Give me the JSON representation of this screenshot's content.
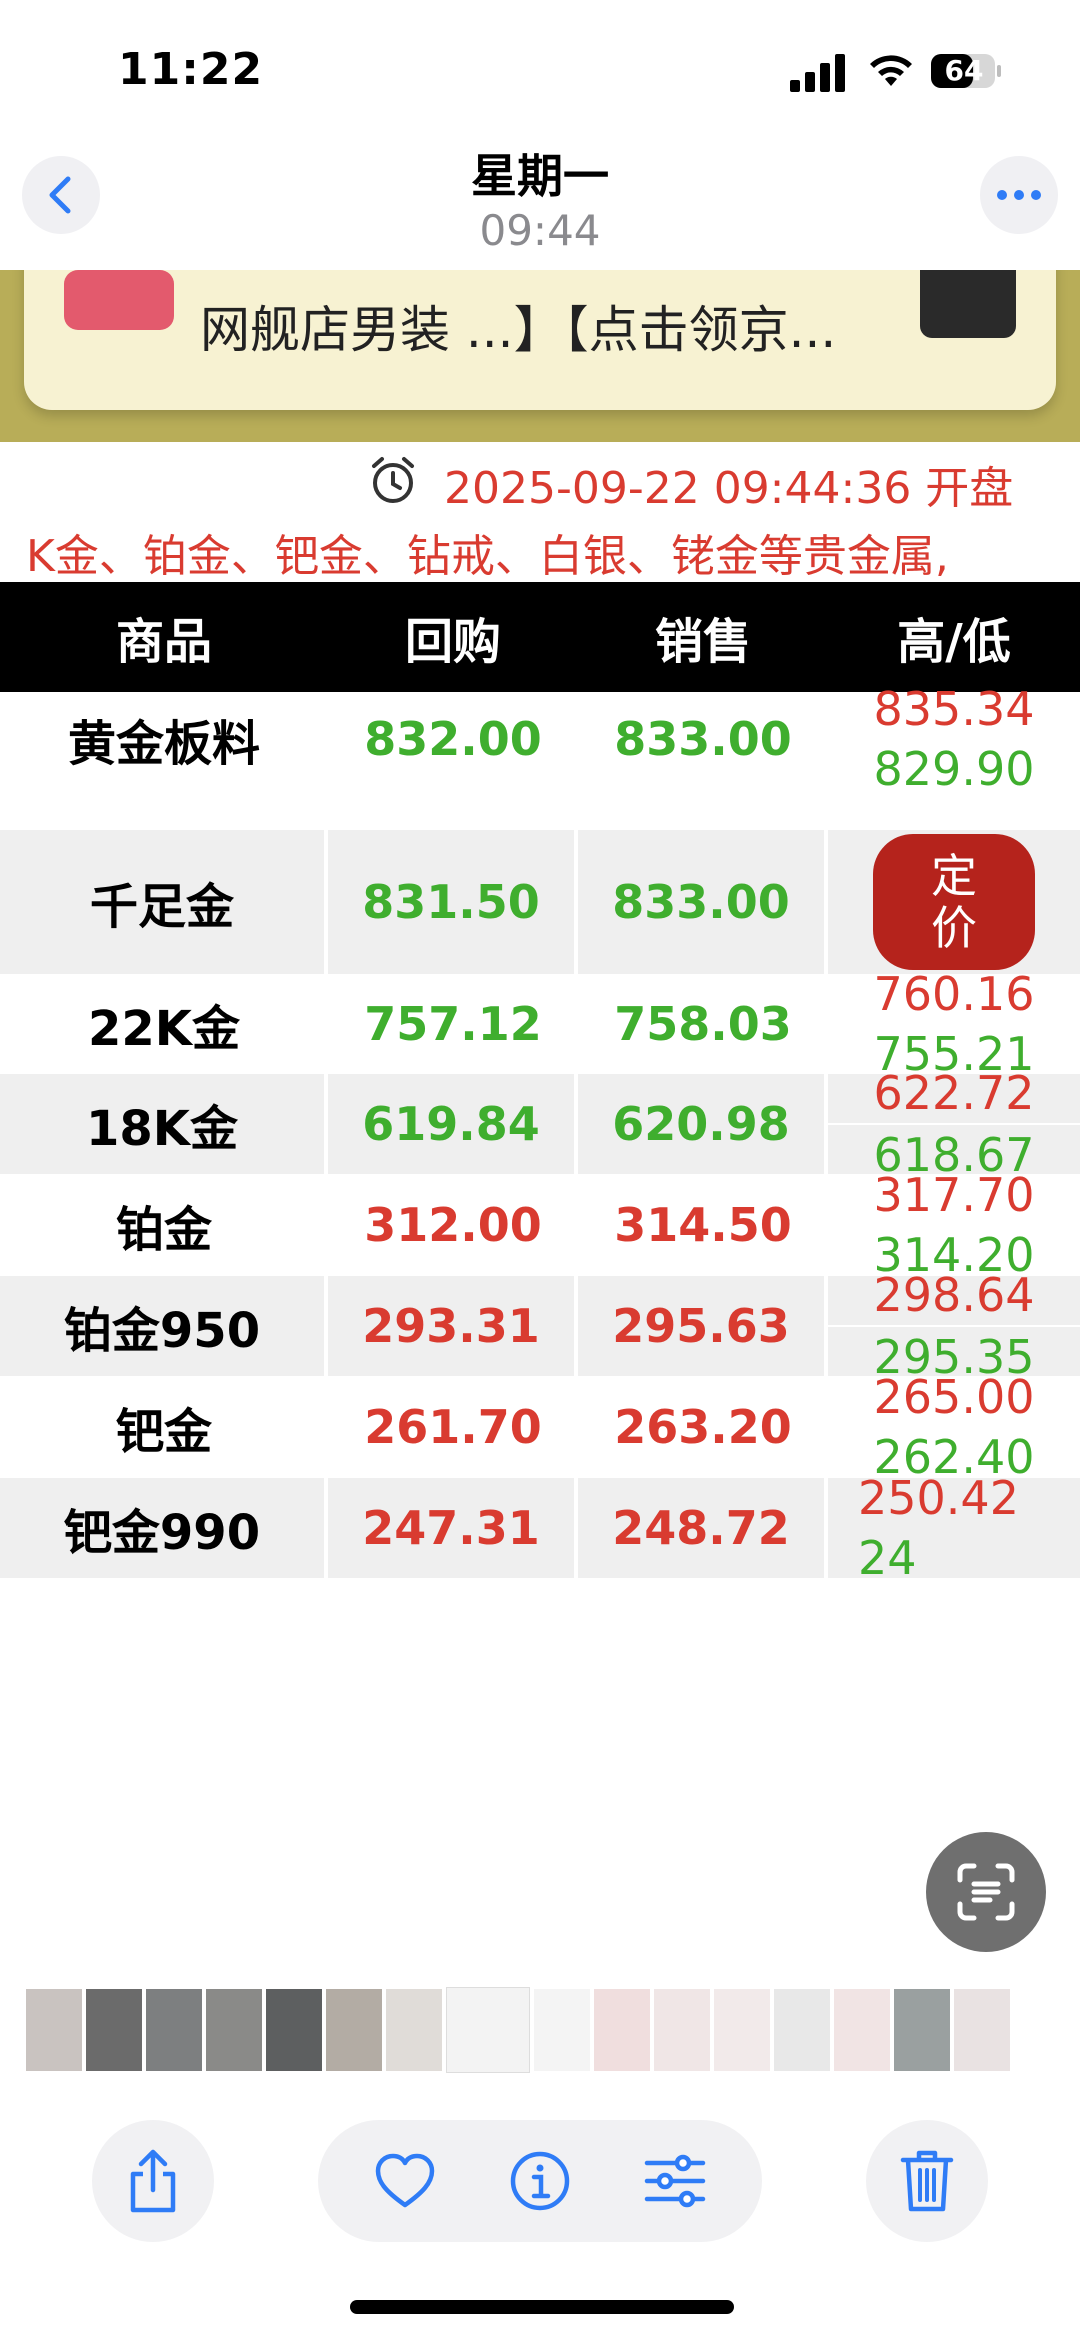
{
  "status_bar": {
    "time": "11:22",
    "battery": "64"
  },
  "nav": {
    "title": "星期一",
    "subtitle": "09:44"
  },
  "banner": {
    "text": "网舰店男装 ...】【点击领京..."
  },
  "info": {
    "datetime": "2025-09-22 09:44:36  开盘",
    "scroll_text": "K金、铂金、钯金、钻戒、白银、铑金等贵金属,"
  },
  "table": {
    "headers": [
      "商品",
      "回购",
      "销售",
      "高/低"
    ],
    "rows": [
      {
        "name": "黄金板料",
        "buy": "832.00",
        "sell": "833.00",
        "high": "835.34",
        "low": "829.90",
        "color": "green",
        "bg": "white"
      },
      {
        "name": "千足金",
        "buy": "831.50",
        "sell": "833.00",
        "action_label_1": "定",
        "action_label_2": "价",
        "color": "green",
        "bg": "gray"
      },
      {
        "name": "22K金",
        "buy": "757.12",
        "sell": "758.03",
        "high": "760.16",
        "low": "755.21",
        "color": "green",
        "bg": "white"
      },
      {
        "name": "18K金",
        "buy": "619.84",
        "sell": "620.98",
        "high": "622.72",
        "low": "618.67",
        "color": "green",
        "bg": "gray"
      },
      {
        "name": "铂金",
        "buy": "312.00",
        "sell": "314.50",
        "high": "317.70",
        "low": "314.20",
        "color": "red",
        "bg": "white"
      },
      {
        "name": "铂金950",
        "buy": "293.31",
        "sell": "295.63",
        "high": "298.64",
        "low": "295.35",
        "color": "red",
        "bg": "gray"
      },
      {
        "name": "钯金",
        "buy": "261.70",
        "sell": "263.20",
        "high": "265.00",
        "low": "262.40",
        "color": "red",
        "bg": "white"
      },
      {
        "name": "钯金990",
        "buy": "247.31",
        "sell": "248.72",
        "high": "250.42",
        "low": "24",
        "color": "red",
        "bg": "gray"
      }
    ]
  },
  "colors": {
    "green": "#3fae2e",
    "red": "#d93b30",
    "header_bg": "#000000",
    "accent": "#2f7cf6"
  },
  "toolbar": {
    "icons": [
      "share-icon",
      "heart-icon",
      "info-icon",
      "adjust-icon",
      "trash-icon"
    ]
  }
}
